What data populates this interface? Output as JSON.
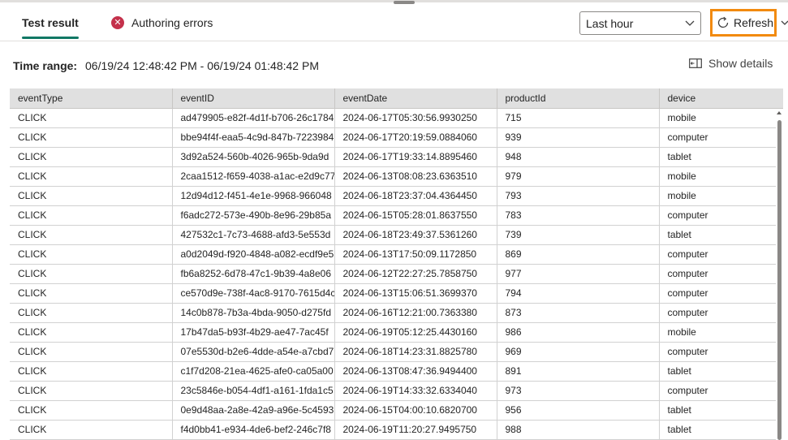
{
  "tabs": [
    {
      "label": "Test result",
      "selected": true
    },
    {
      "label": "Authoring errors",
      "icon": "error-circle-icon"
    }
  ],
  "time_select": {
    "value": "Last hour"
  },
  "refresh": {
    "label": "Refresh",
    "highlight_color": "#f28a0f"
  },
  "time_range": {
    "label": "Time range:",
    "value": "06/19/24 12:48:42 PM - 06/19/24 01:48:42 PM"
  },
  "show_details": {
    "label": "Show details"
  },
  "table": {
    "columns": [
      "eventType",
      "eventID",
      "eventDate",
      "productId",
      "device"
    ],
    "rows": [
      [
        "CLICK",
        "ad479905-e82f-4d1f-b706-26c1784",
        "2024-06-17T05:30:56.9930250",
        "715",
        "mobile"
      ],
      [
        "CLICK",
        "bbe94f4f-eaa5-4c9d-847b-7223984",
        "2024-06-17T20:19:59.0884060",
        "939",
        "computer"
      ],
      [
        "CLICK",
        "3d92a524-560b-4026-965b-9da9d",
        "2024-06-17T19:33:14.8895460",
        "948",
        "tablet"
      ],
      [
        "CLICK",
        "2caa1512-f659-4038-a1ac-e2d9c77",
        "2024-06-13T08:08:23.6363510",
        "979",
        "mobile"
      ],
      [
        "CLICK",
        "12d94d12-f451-4e1e-9968-966048",
        "2024-06-18T23:37:04.4364450",
        "793",
        "mobile"
      ],
      [
        "CLICK",
        "f6adc272-573e-490b-8e96-29b85a",
        "2024-06-15T05:28:01.8637550",
        "783",
        "computer"
      ],
      [
        "CLICK",
        "427532c1-7c73-4688-afd3-5e553d",
        "2024-06-18T23:49:37.5361260",
        "739",
        "tablet"
      ],
      [
        "CLICK",
        "a0d2049d-f920-4848-a082-ecdf9e5",
        "2024-06-13T17:50:09.1172850",
        "869",
        "computer"
      ],
      [
        "CLICK",
        "fb6a8252-6d78-47c1-9b39-4a8e06",
        "2024-06-12T22:27:25.7858750",
        "977",
        "computer"
      ],
      [
        "CLICK",
        "ce570d9e-738f-4ac8-9170-7615d4c",
        "2024-06-13T15:06:51.3699370",
        "794",
        "computer"
      ],
      [
        "CLICK",
        "14c0b878-7b3a-4bda-9050-d275fd",
        "2024-06-16T12:21:00.7363380",
        "873",
        "computer"
      ],
      [
        "CLICK",
        "17b47da5-b93f-4b29-ae47-7ac45f",
        "2024-06-19T05:12:25.4430160",
        "986",
        "mobile"
      ],
      [
        "CLICK",
        "07e5530d-b2e6-4dde-a54e-a7cbd7",
        "2024-06-18T14:23:31.8825780",
        "969",
        "computer"
      ],
      [
        "CLICK",
        "c1f7d208-21ea-4625-afe0-ca05a00",
        "2024-06-13T08:47:36.9494400",
        "891",
        "tablet"
      ],
      [
        "CLICK",
        "23c5846e-b054-4df1-a161-1fda1c5",
        "2024-06-19T14:33:32.6334040",
        "973",
        "computer"
      ],
      [
        "CLICK",
        "0e9d48aa-2a8e-42a9-a96e-5c4593",
        "2024-06-15T04:00:10.6820700",
        "956",
        "tablet"
      ],
      [
        "CLICK",
        "f4d0bb41-e934-4de6-bef2-246c7f8",
        "2024-06-19T11:20:27.9495750",
        "988",
        "tablet"
      ]
    ]
  }
}
